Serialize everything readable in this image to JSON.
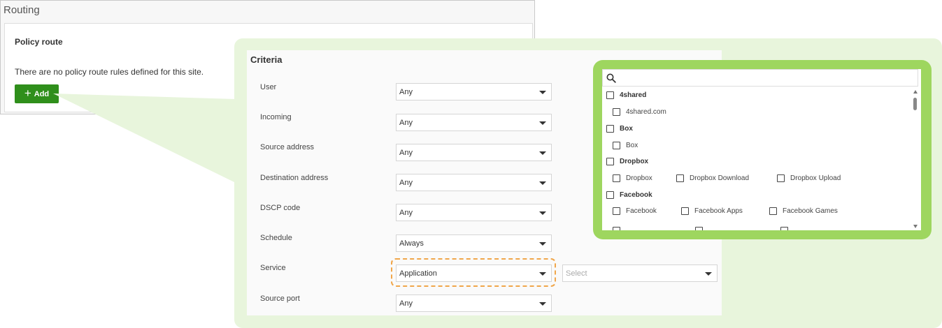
{
  "routing": {
    "title": "Routing",
    "policy_title": "Policy route",
    "empty_message": "There are no policy route rules defined for this site.",
    "add_label": "Add"
  },
  "criteria": {
    "title": "Criteria",
    "rows": [
      {
        "label": "User",
        "value": "Any"
      },
      {
        "label": "Incoming",
        "value": "Any"
      },
      {
        "label": "Source address",
        "value": "Any"
      },
      {
        "label": "Destination address",
        "value": "Any"
      },
      {
        "label": "DSCP code",
        "value": "Any"
      },
      {
        "label": "Schedule",
        "value": "Always"
      },
      {
        "label": "Service",
        "value": "Application"
      },
      {
        "label": "Source port",
        "value": "Any"
      }
    ],
    "service_select_placeholder": "Select"
  },
  "app_list": {
    "groups": [
      {
        "name": "4shared",
        "items": [
          "4shared.com"
        ]
      },
      {
        "name": "Box",
        "items": [
          "Box"
        ]
      },
      {
        "name": "Dropbox",
        "items": [
          "Dropbox",
          "Dropbox Download",
          "Dropbox Upload"
        ]
      },
      {
        "name": "Facebook",
        "items": [
          "Facebook",
          "Facebook Apps",
          "Facebook Games"
        ]
      }
    ]
  },
  "colors": {
    "add_button": "#2f8f1b",
    "callout_green": "#e8f5dc",
    "bubble_green": "#9ed65f",
    "highlight_dash": "#f0a64a"
  }
}
